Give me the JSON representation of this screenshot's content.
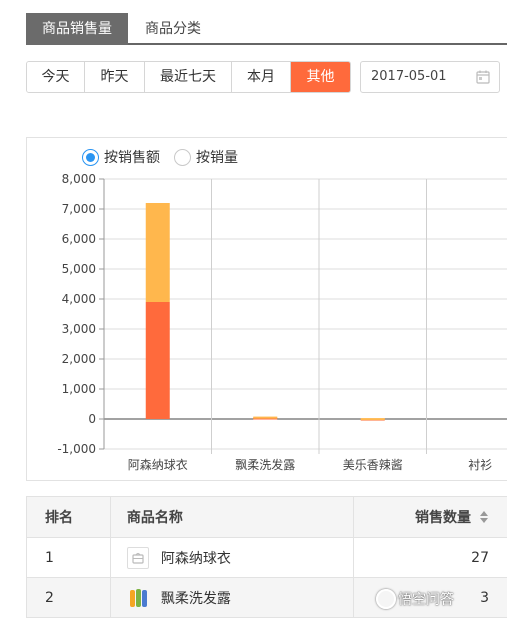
{
  "tabs": [
    {
      "label": "商品销售量",
      "active": true
    },
    {
      "label": "商品分类",
      "active": false
    }
  ],
  "filters": [
    {
      "label": "今天",
      "active": false
    },
    {
      "label": "昨天",
      "active": false
    },
    {
      "label": "最近七天",
      "active": false
    },
    {
      "label": "本月",
      "active": false
    },
    {
      "label": "其他",
      "active": true
    }
  ],
  "date": {
    "value": "2017-05-01",
    "icon": "calendar-icon"
  },
  "radios": [
    {
      "label": "按销售额",
      "checked": true
    },
    {
      "label": "按销量",
      "checked": false
    }
  ],
  "chart_data": {
    "type": "bar",
    "stacked": true,
    "categories": [
      "阿森纳球衣",
      "飘柔洗发露",
      "美乐香辣酱",
      "衬衫"
    ],
    "series": [
      {
        "values": [
          3900,
          50,
          15,
          0
        ],
        "color": "#ff6a3c"
      },
      {
        "values": [
          3300,
          30,
          15,
          0
        ],
        "color": "#ffb74d"
      }
    ],
    "ylim": [
      -1000,
      8000
    ],
    "yticks": [
      "-1,000",
      "0",
      "1,000",
      "2,000",
      "3,000",
      "4,000",
      "5,000",
      "6,000",
      "7,000",
      "8,000"
    ],
    "ytick_values": [
      -1000,
      0,
      1000,
      2000,
      3000,
      4000,
      5000,
      6000,
      7000,
      8000
    ],
    "grid": true
  },
  "table": {
    "headers": [
      "排名",
      "商品名称",
      "销售数量"
    ],
    "rows": [
      {
        "rank": "1",
        "name": "阿森纳球衣",
        "qty": "27",
        "icon": "image-placeholder-icon"
      },
      {
        "rank": "2",
        "name": "飘柔洗发露",
        "qty": "3",
        "icon": "product-thumbnail-icon"
      }
    ],
    "sort_icon": "sort-icon"
  },
  "watermark": "悟空问答"
}
